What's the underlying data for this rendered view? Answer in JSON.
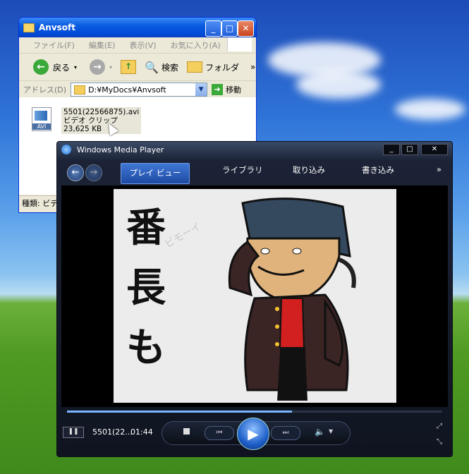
{
  "explorer": {
    "title": "Anvsoft",
    "menu": [
      "ファイル(F)",
      "編集(E)",
      "表示(V)",
      "お気に入り(A)"
    ],
    "menu_more": "»",
    "toolbar": {
      "back": "戻る",
      "search": "検索",
      "folders": "フォルダ",
      "more": "»"
    },
    "address_label": "アドレス(D)",
    "address_value": "D:¥MyDocs¥Anvsoft",
    "go_label": "移動",
    "file": {
      "name": "5501(22566875).avi",
      "type": "ビデオ クリップ",
      "size": "23,625 KB"
    },
    "status_text": "種類: ビデ"
  },
  "wmp": {
    "title": "Windows Media Player",
    "tabs": {
      "now_playing": "プレイ ビュー",
      "library": "ライブラリ",
      "rip": "取り込み",
      "burn": "書き込み",
      "more": "»"
    },
    "video_text": [
      "番",
      "長",
      "も"
    ],
    "watermark": "ビモーイ",
    "now_playing_title": "5501(22...",
    "time": "01:44",
    "progress": 0.6
  }
}
